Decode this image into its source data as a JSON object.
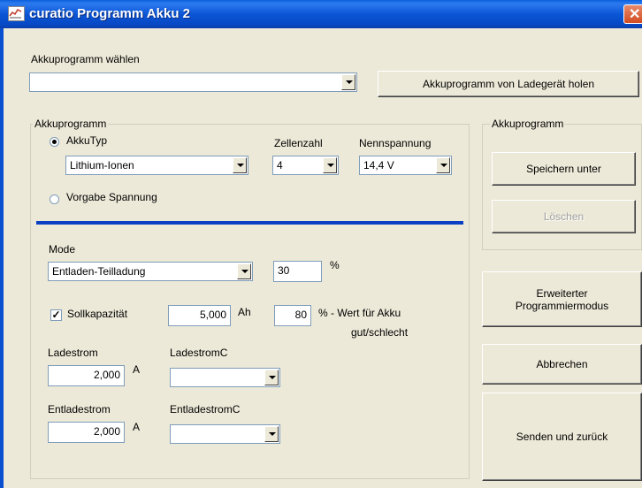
{
  "window": {
    "title": "curatio Programm Akku 2"
  },
  "select_program": {
    "label": "Akkuprogramm wählen",
    "value": "",
    "fetch_button": "Akkuprogramm von Ladegerät holen"
  },
  "akkuprogramm": {
    "group_title": "Akkuprogramm",
    "akkutyp_label": "AkkuTyp",
    "akkutyp_value": "Lithium-Ionen",
    "zellenzahl_label": "Zellenzahl",
    "zellenzahl_value": "4",
    "nennspannung_label": "Nennspannung",
    "nennspannung_value": "14,4 V",
    "vorgabe_label": "Vorgabe Spannung",
    "selected_radio": "AkkuTyp",
    "accent_color": "#0b3fc4"
  },
  "mode": {
    "label": "Mode",
    "value": "Entladen-Teilladung",
    "percent_value": "30",
    "percent_unit": "%"
  },
  "sollkapazitaet": {
    "checked": true,
    "label": "Sollkapazität",
    "value": "5,000",
    "unit": "Ah",
    "percent_value": "80",
    "percent_text": "% - Wert für Akku",
    "percent_text2": "gut/schlecht"
  },
  "ladestrom": {
    "label": "Ladestrom",
    "value": "2,000",
    "unit": "A",
    "c_label": "LadestromC",
    "c_value": ""
  },
  "entladestrom": {
    "label": "Entladestrom",
    "value": "2,000",
    "unit": "A",
    "c_label": "EntladestromC",
    "c_value": ""
  },
  "right_panel": {
    "group_title": "Akkuprogramm",
    "save_as": "Speichern unter",
    "delete": "Löschen",
    "advanced_line1": "Erweiterter",
    "advanced_line2": "Programmiermodus",
    "cancel": "Abbrechen",
    "send_back": "Senden und zurück"
  }
}
